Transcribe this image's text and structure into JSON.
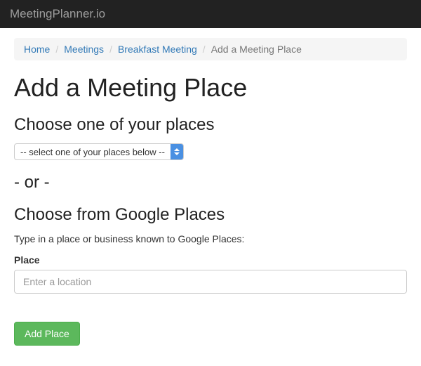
{
  "brand": "MeetingPlanner.io",
  "breadcrumb": {
    "items": [
      {
        "label": "Home"
      },
      {
        "label": "Meetings"
      },
      {
        "label": "Breakfast Meeting"
      }
    ],
    "active": "Add a Meeting Place"
  },
  "page_title": "Add a Meeting Place",
  "section_choose_own": "Choose one of your places",
  "place_select": {
    "selected": "-- select one of your places below --"
  },
  "or_text": "- or -",
  "section_google": "Choose from Google Places",
  "google_help": "Type in a place or business known to Google Places:",
  "place_field": {
    "label": "Place",
    "placeholder": "Enter a location",
    "value": ""
  },
  "submit_label": "Add Place"
}
